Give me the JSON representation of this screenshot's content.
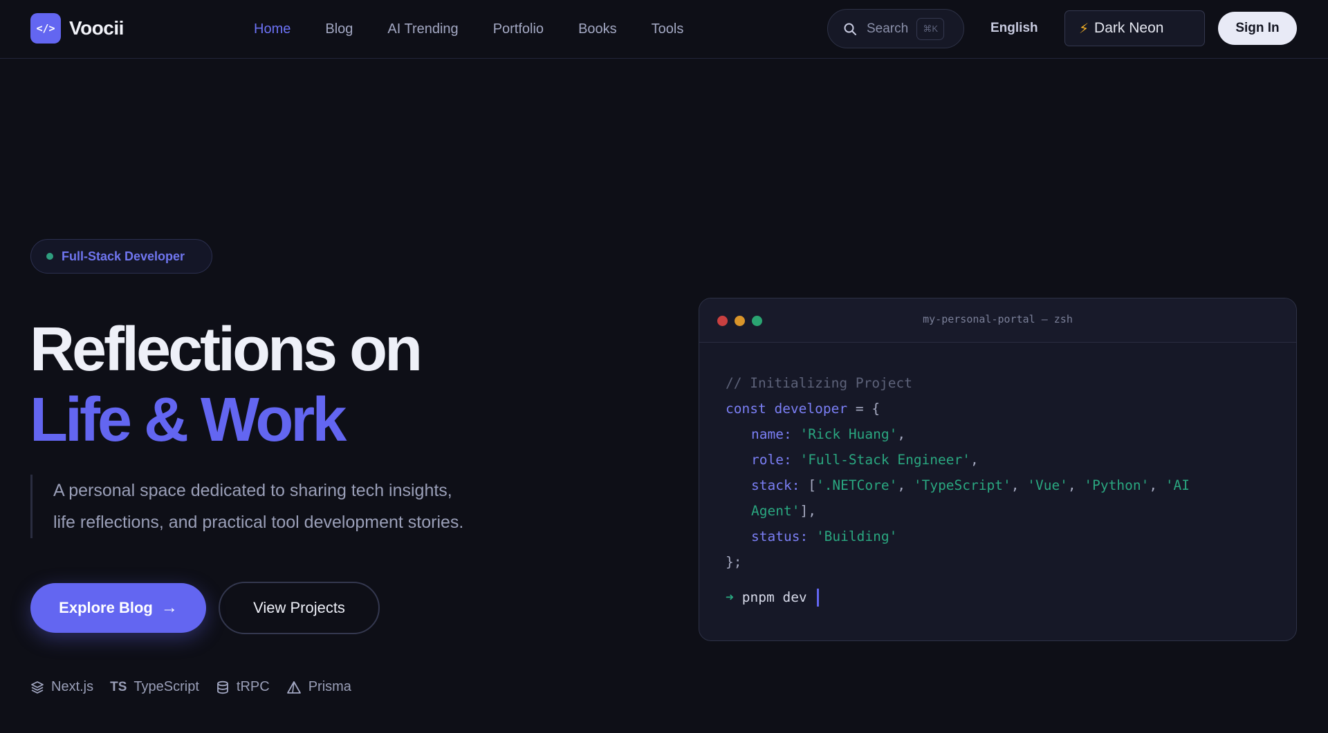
{
  "header": {
    "brand_name": "Voocii",
    "brand_glyph": "</>",
    "nav": [
      {
        "label": "Home",
        "active": true
      },
      {
        "label": "Blog"
      },
      {
        "label": "AI Trending"
      },
      {
        "label": "Portfolio"
      },
      {
        "label": "Books"
      },
      {
        "label": "Tools"
      }
    ],
    "search_label": "Search",
    "search_shortcut": "⌘K",
    "language": "English",
    "theme_icon": "⚡",
    "theme_label": "Dark Neon",
    "signin_label": "Sign In"
  },
  "hero": {
    "badge": "Full-Stack Developer",
    "headline_line1": "Reflections on",
    "headline_line2": "Life & Work",
    "description_line1": "A personal space dedicated to sharing tech insights,",
    "description_line2": "life reflections, and practical tool development stories.",
    "primary_button": "Explore Blog",
    "primary_button_icon": "→",
    "secondary_button": "View Projects",
    "tech_stack": [
      "Next.js",
      "TypeScript",
      "tRPC",
      "Prisma"
    ],
    "typescript_glyph": "TS"
  },
  "terminal": {
    "title": "my-personal-portal — zsh",
    "comment": "// Initializing Project",
    "kw_const": "const",
    "var_name": "developer",
    "assign_open": " = {",
    "name_key": "name:",
    "name_val": "'Rick Huang'",
    "role_key": "role:",
    "role_val": "'Full-Stack Engineer'",
    "stack_key": "stack:",
    "stack_vals": [
      "'.NETCore'",
      "'TypeScript'",
      "'Vue'",
      "'Python'"
    ],
    "stack_last_part1": "'AI",
    "stack_last_part2": "Agent'",
    "status_key": "status:",
    "status_val": "'Building'",
    "close": "};",
    "prompt_symbol": "➜",
    "prompt_cmd": "pnpm dev"
  },
  "colors": {
    "accent": "#6366f1",
    "string": "#2aa780",
    "background": "#0e0f17"
  }
}
